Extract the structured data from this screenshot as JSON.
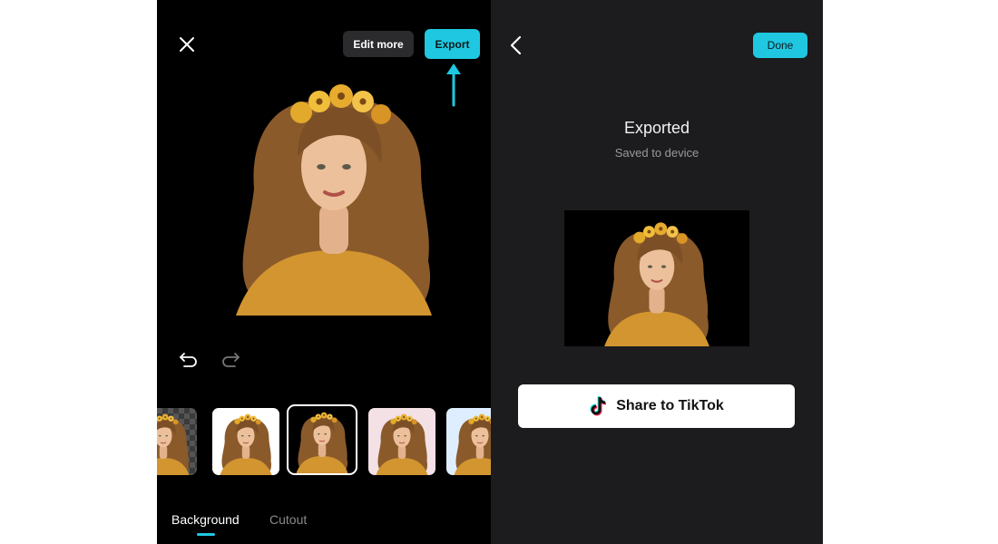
{
  "left_screen": {
    "toolbar": {
      "edit_more_label": "Edit more",
      "export_label": "Export"
    },
    "tabs": [
      {
        "label": "Background",
        "active": true
      },
      {
        "label": "Cutout",
        "active": false
      }
    ],
    "thumbnails": [
      {
        "background": "transparent"
      },
      {
        "background": "#ffffff"
      },
      {
        "background": "#000000",
        "selected": true
      },
      {
        "background": "#f3e1e6"
      },
      {
        "background": "#dfeeff"
      }
    ]
  },
  "right_screen": {
    "done_label": "Done",
    "title": "Exported",
    "subtitle": "Saved to device",
    "share_label": "Share to TikTok"
  },
  "colors": {
    "accent": "#1fc8e0",
    "dark_bg": "#1c1c1e",
    "left_bg": "#000000"
  }
}
